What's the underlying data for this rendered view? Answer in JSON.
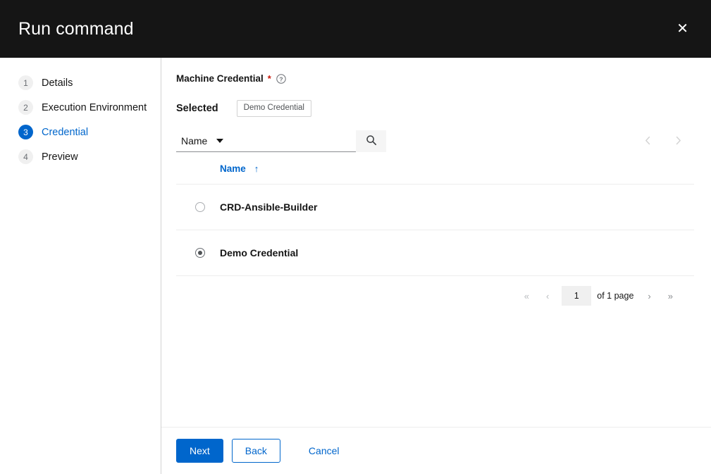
{
  "header": {
    "title": "Run command",
    "close_label": "✕"
  },
  "sidebar": {
    "items": [
      {
        "num": "1",
        "label": "Details"
      },
      {
        "num": "2",
        "label": "Execution Environment"
      },
      {
        "num": "3",
        "label": "Credential"
      },
      {
        "num": "4",
        "label": "Preview"
      }
    ],
    "active_index": 2
  },
  "form": {
    "field_label": "Machine Credential",
    "required_mark": "*",
    "help_icon": "question-circle-icon",
    "selected_label": "Selected",
    "selected_chips": [
      "Demo Credential"
    ]
  },
  "toolbar": {
    "attribute_select_value": "Name",
    "search_placeholder": "",
    "search_value": "",
    "search_icon": "search-icon",
    "prev_icon": "chevron-left-icon",
    "next_icon": "chevron-right-icon"
  },
  "table": {
    "columns": [
      "Name"
    ],
    "sort_indicator": "↑",
    "rows": [
      {
        "name": "CRD-Ansible-Builder",
        "selected": false
      },
      {
        "name": "Demo Credential",
        "selected": true
      }
    ]
  },
  "pagination": {
    "first_label": "«",
    "prev_label": "‹",
    "page_value": "1",
    "of_text": "of 1 page",
    "next_label": "›",
    "last_label": "»"
  },
  "footer": {
    "next_label": "Next",
    "back_label": "Back",
    "cancel_label": "Cancel"
  },
  "colors": {
    "header_bg": "#151515",
    "accent": "#0066cc",
    "required": "#c9190b",
    "divider": "#d2d2d2"
  }
}
